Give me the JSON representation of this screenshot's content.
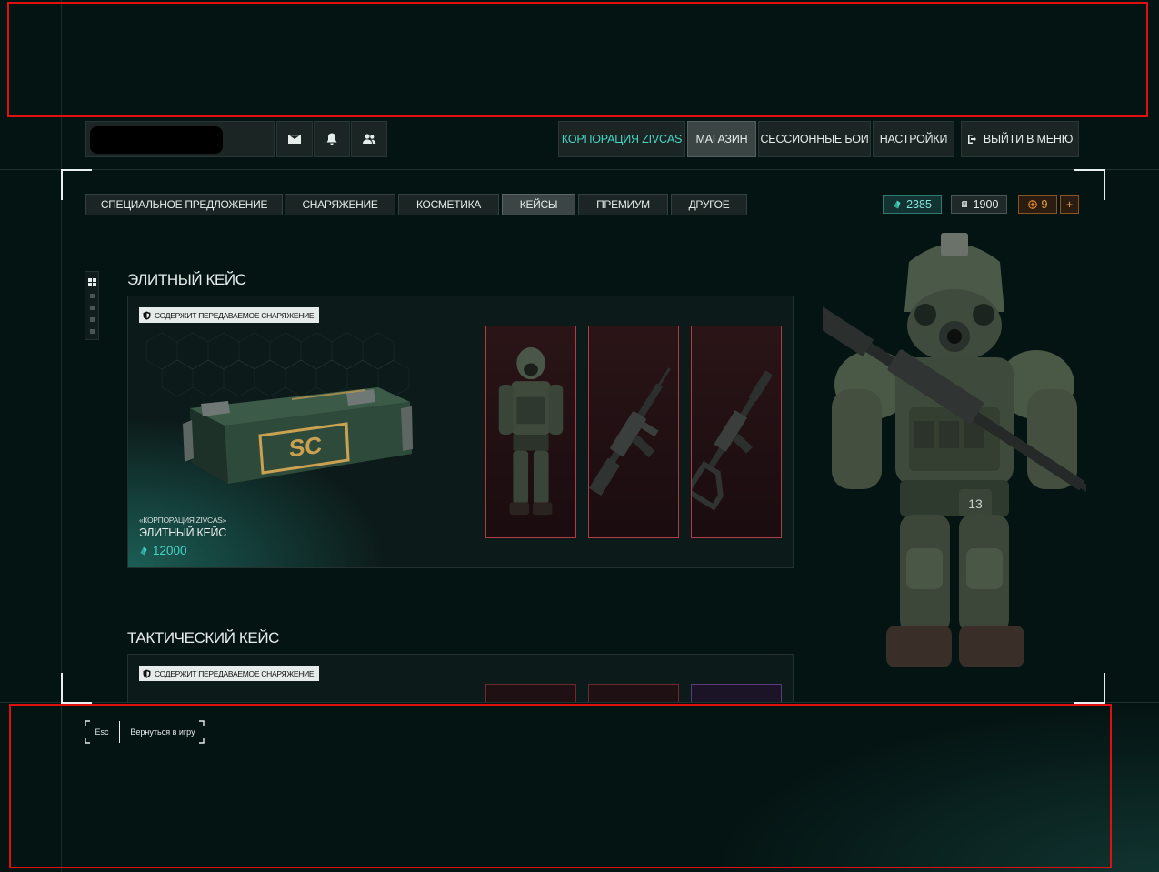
{
  "header": {
    "player_name": "",
    "mail_icon": "mail-icon",
    "bell_icon": "bell-icon",
    "friends_icon": "friends-icon",
    "nav": {
      "corporation": "КОРПОРАЦИЯ ZIVCAS",
      "shop": "МАГАЗИН",
      "session_battles": "СЕССИОННЫЕ БОИ",
      "settings": "НАСТРОЙКИ",
      "exit_menu": "ВЫЙТИ В МЕНЮ"
    },
    "active_nav": "shop"
  },
  "tabs": [
    {
      "label": "СПЕЦИАЛЬНОЕ ПРЕДЛОЖЕНИЕ",
      "active": false
    },
    {
      "label": "СНАРЯЖЕНИЕ",
      "active": false
    },
    {
      "label": "КОСМЕТИКА",
      "active": false
    },
    {
      "label": "КЕЙСЫ",
      "active": true
    },
    {
      "label": "ПРЕМИУМ",
      "active": false
    },
    {
      "label": "ДРУГОЕ",
      "active": false
    }
  ],
  "currencies": {
    "crystals": "2385",
    "silver": "1900",
    "tokens": "9",
    "add_label": "+",
    "crystal_color": "#47d4c6",
    "token_color": "#e0882a"
  },
  "cases": [
    {
      "title": "ЭЛИТНЫЙ КЕЙС",
      "badge": "СОДЕРЖИТ ПЕРЕДАВАЕМОЕ СНАРЯЖЕНИЕ",
      "subtitle": "«КОРПОРАЦИЯ ZIVCAS»",
      "name": "ЭЛИТНЫЙ КЕЙС",
      "price": "12000",
      "case_label": "SC",
      "items": [
        "armor-suit-item",
        "assault-rifle-item",
        "sniper-rifle-item"
      ]
    },
    {
      "title": "ТАКТИЧЕСКИЙ КЕЙС",
      "badge": "СОДЕРЖИТ ПЕРЕДАВАЕМОЕ СНАРЯЖЕНИЕ"
    }
  ],
  "footer": {
    "esc_key": "Esc",
    "esc_label": "Вернуться в игру"
  },
  "soldier_badge": "13"
}
